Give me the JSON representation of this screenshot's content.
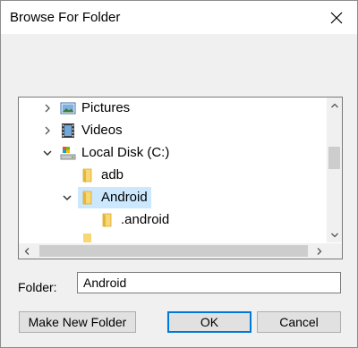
{
  "window": {
    "title": "Browse For Folder"
  },
  "icons": {
    "close": "close-icon",
    "pictures": "pictures-icon",
    "videos": "videos-icon",
    "disk": "hard-disk-icon",
    "folder": "folder-icon"
  },
  "tree": {
    "items": [
      {
        "label": "Pictures",
        "expander": "collapsed",
        "icon": "pictures-icon"
      },
      {
        "label": "Videos",
        "expander": "collapsed",
        "icon": "videos-icon"
      },
      {
        "label": "Local Disk (C:)",
        "expander": "expanded",
        "icon": "hard-disk-icon"
      },
      {
        "label": "adb",
        "expander": "none",
        "icon": "folder-icon"
      },
      {
        "label": "Android",
        "expander": "expanded",
        "icon": "folder-icon",
        "selected": true
      },
      {
        "label": ".android",
        "expander": "none",
        "icon": "folder-icon"
      }
    ]
  },
  "folder": {
    "label": "Folder:",
    "value": "Android"
  },
  "buttons": {
    "make_new_folder": "Make New Folder",
    "ok": "OK",
    "cancel": "Cancel"
  },
  "colors": {
    "selection": "#cce8ff",
    "folder_yellow": "#f8d775",
    "default_button_border": "#0078d7"
  }
}
